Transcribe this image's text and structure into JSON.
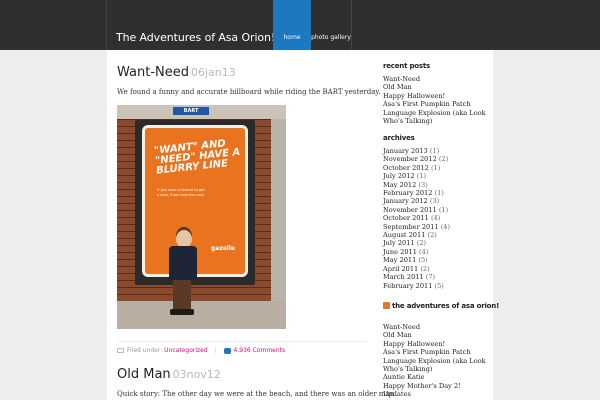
{
  "site": {
    "title": "The Adventures of Asa Orion!",
    "nav": [
      {
        "label": "home",
        "active": true
      },
      {
        "label": "photo gallery",
        "active": false
      }
    ],
    "accent_color": "#1b78c1",
    "link_color": "#c0147a"
  },
  "posts": [
    {
      "title": "Want-Need",
      "date": "06jan13",
      "excerpt": "We found a funny and accurate billboard while riding the BART yesterday.",
      "photo": {
        "sign_text": "BART",
        "poster_text": "\"WANT\" AND \"NEED\" HAVE A BLURRY LINE",
        "poster_small_text": "If you have a license to get a deal, if we have the cash",
        "poster_brand": "gazelle"
      },
      "meta": {
        "filed_under_label": "Filed under:",
        "category": "Uncategorized",
        "comments": "4,936 Comments"
      }
    },
    {
      "title": "Old Man",
      "date": "03nov12",
      "excerpt": "Quick story: The other day we were at the beach, and there was an older man"
    }
  ],
  "sidebar": {
    "recent_posts": {
      "heading": "recent posts",
      "items": [
        "Want-Need",
        "Old Man",
        "Happy Halloween!",
        "Asa's First Pumpkin Patch",
        "Language Explosion (aka Look Who's Talking)"
      ]
    },
    "archives": {
      "heading": "archives",
      "items": [
        {
          "month": "January 2013",
          "count": "(1)"
        },
        {
          "month": "November 2012",
          "count": "(2)"
        },
        {
          "month": "October 2012",
          "count": "(1)"
        },
        {
          "month": "July 2012",
          "count": "(1)"
        },
        {
          "month": "May 2012",
          "count": "(3)"
        },
        {
          "month": "February 2012",
          "count": "(1)"
        },
        {
          "month": "January 2012",
          "count": "(3)"
        },
        {
          "month": "November 2011",
          "count": "(1)"
        },
        {
          "month": "October 2011",
          "count": "(4)"
        },
        {
          "month": "September 2011",
          "count": "(4)"
        },
        {
          "month": "August 2011",
          "count": "(2)"
        },
        {
          "month": "July 2011",
          "count": "(2)"
        },
        {
          "month": "June 2011",
          "count": "(4)"
        },
        {
          "month": "May 2011",
          "count": "(5)"
        },
        {
          "month": "April 2011",
          "count": "(2)"
        },
        {
          "month": "March 2011",
          "count": "(7)"
        },
        {
          "month": "February 2011",
          "count": "(5)"
        }
      ]
    },
    "feed": {
      "heading": "the adventures of asa orion!",
      "icon": "rss-icon",
      "items": [
        "Want-Need",
        "Old Man",
        "Happy Halloween!",
        "Asa's First Pumpkin Patch",
        "Language Explosion (aka Look Who's Talking)",
        "Auntie Katie",
        "Happy Mother's Day 2!",
        "Updates"
      ]
    }
  }
}
